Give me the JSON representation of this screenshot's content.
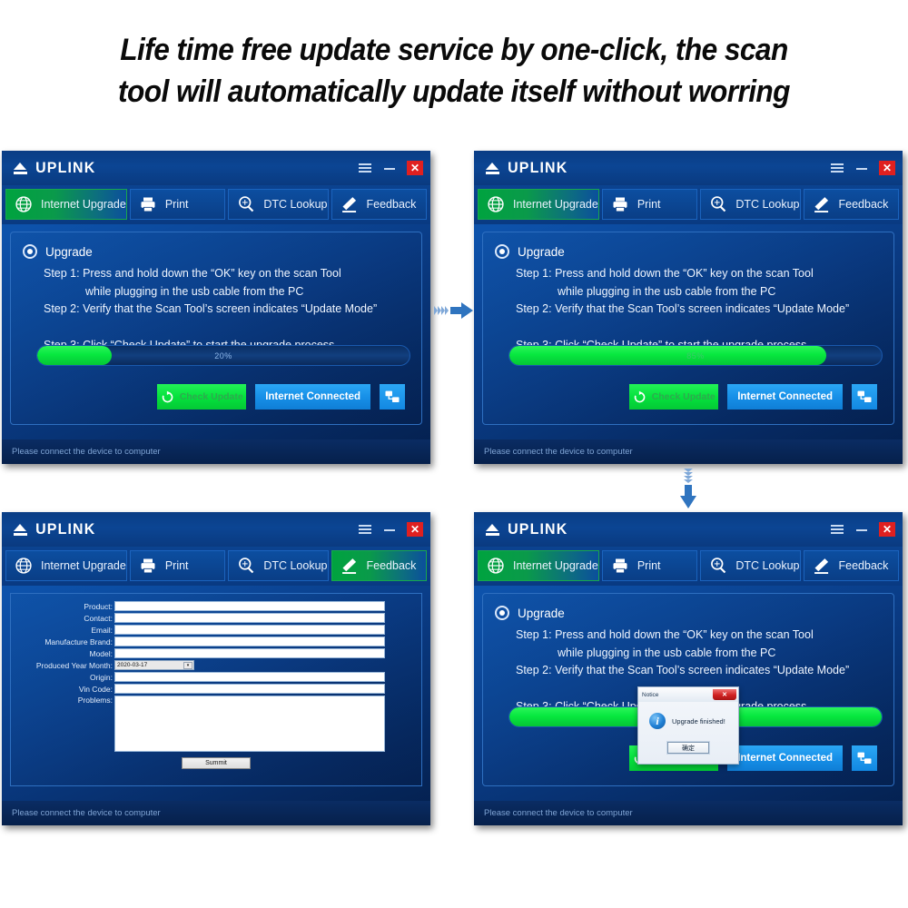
{
  "headline": {
    "line1": "Life time free update service by one-click, the scan",
    "line2": "tool will automatically update itself without worring"
  },
  "app": {
    "brand": "UPLINK",
    "window_controls": {
      "menu": "menu-icon",
      "minimize": "–",
      "close": "✕"
    },
    "toolbar": [
      {
        "label": "Internet Upgrade",
        "icon": "globe-icon"
      },
      {
        "label": "Print",
        "icon": "printer-icon"
      },
      {
        "label": "DTC Lookup",
        "icon": "magnifier-icon"
      },
      {
        "label": "Feedback",
        "icon": "pencil-icon"
      }
    ],
    "upgrade": {
      "section_label": "Upgrade",
      "step1": "Step 1: Press and hold down the “OK” key on the scan Tool",
      "step1b": "while plugging in the usb cable from the PC",
      "step2": "Step 2: Verify that the Scan Tool’s screen indicates “Update Mode”",
      "step3": "Step 3: Click “Check Update” to start the upgrade process"
    },
    "buttons": {
      "check_update": "Check Update",
      "internet_connected": "Internet Connected",
      "network_icon": "network-monitors-icon"
    },
    "statusbar": "Please connect the device to computer"
  },
  "panels": {
    "p1": {
      "active_tab": 0,
      "progress_percent": 20,
      "progress_label": "20%"
    },
    "p2": {
      "active_tab": 0,
      "progress_percent": 85,
      "progress_label": "85%"
    },
    "p3": {
      "active_tab": 3
    },
    "p4": {
      "active_tab": 0,
      "progress_percent": 100,
      "progress_label": "100%"
    }
  },
  "feedback_form": {
    "fields": [
      {
        "label": "Product:",
        "type": "text",
        "value": ""
      },
      {
        "label": "Contact:",
        "type": "text",
        "value": ""
      },
      {
        "label": "Email:",
        "type": "text",
        "value": ""
      },
      {
        "label": "Manufacture Brand:",
        "type": "text",
        "value": ""
      },
      {
        "label": "Model:",
        "type": "text",
        "value": ""
      },
      {
        "label": "Produced Year Month:",
        "type": "select",
        "value": "2020-03-17"
      },
      {
        "label": "Origin:",
        "type": "text",
        "value": ""
      },
      {
        "label": "Vin Code:",
        "type": "text",
        "value": ""
      },
      {
        "label": "Problems:",
        "type": "textarea",
        "value": ""
      }
    ],
    "submit_label": "Summit",
    "select_arrow": "▾"
  },
  "dialog": {
    "title": "Notice",
    "close": "✕",
    "message": "Upgrade finished!",
    "ok_label": "确定",
    "icon": "info-icon"
  },
  "arrows": {
    "right": "arrow-right-icon",
    "down": "arrow-down-icon"
  },
  "colors": {
    "accent_green": "#05e23d",
    "accent_blue": "#1790e8",
    "close_red": "#e02020",
    "window_blue": "#0b4593"
  }
}
